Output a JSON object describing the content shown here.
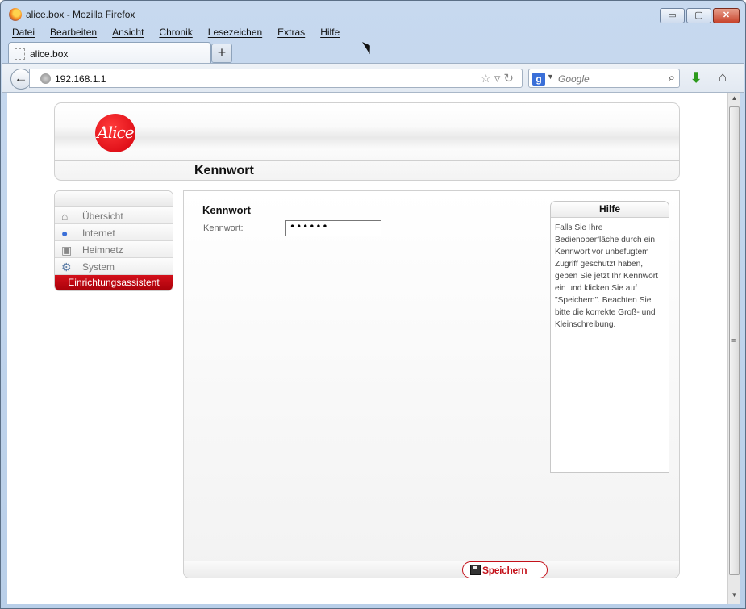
{
  "window": {
    "title": "alice.box - Mozilla Firefox",
    "controls": {
      "minimize": "▭",
      "maximize": "▢",
      "close": "✕"
    }
  },
  "menu": [
    "Datei",
    "Bearbeiten",
    "Ansicht",
    "Chronik",
    "Lesezeichen",
    "Extras",
    "Hilfe"
  ],
  "tab": {
    "label": "alice.box",
    "new_tab": "+"
  },
  "navbar": {
    "url": "192.168.1.1",
    "search_placeholder": "Google",
    "search_engine_icon": "google-icon"
  },
  "page": {
    "logo_text": "Alice",
    "title": "Kennwort",
    "sidebar": {
      "items": [
        {
          "label": "Übersicht",
          "icon": "house-icon"
        },
        {
          "label": "Internet",
          "icon": "globe-icon"
        },
        {
          "label": "Heimnetz",
          "icon": "network-icon"
        },
        {
          "label": "System",
          "icon": "gears-icon"
        }
      ],
      "wizard": "Einrichtungsassistent"
    },
    "form": {
      "heading": "Kennwort",
      "password_label": "Kennwort:",
      "password_value": "••••••"
    },
    "help": {
      "title": "Hilfe",
      "text": "Falls Sie Ihre Bedienoberfläche durch ein Kennwort vor unbefugtem Zugriff geschützt haben, geben Sie jetzt Ihr Kennwort ein und klicken Sie auf \"Speichern\". Beachten Sie bitte die korrekte Groß- und Kleinschreibung."
    },
    "save_button": "Speichern"
  },
  "colors": {
    "brand_red": "#d4000c",
    "window_frame": "#c7d9ef"
  }
}
